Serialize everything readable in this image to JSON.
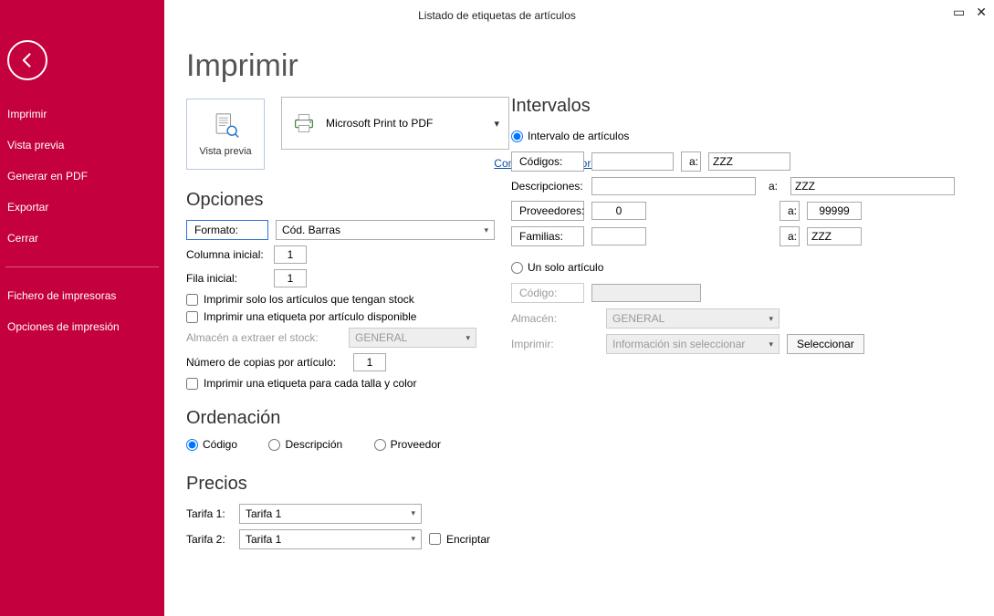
{
  "window": {
    "title": "Listado de etiquetas de artículos"
  },
  "sidebar": {
    "items": [
      "Imprimir",
      "Vista previa",
      "Generar en PDF",
      "Exportar",
      "Cerrar"
    ],
    "items2": [
      "Fichero de impresoras",
      "Opciones de impresión"
    ]
  },
  "main": {
    "title": "Imprimir",
    "preview_label": "Vista previa",
    "printer_name": "Microsoft Print to PDF",
    "configure_link": "Configurar impresora",
    "opciones": {
      "heading": "Opciones",
      "formato_label": "Formato:",
      "formato_value": "Cód. Barras",
      "col_label": "Columna inicial:",
      "col_value": "1",
      "fila_label": "Fila inicial:",
      "fila_value": "1",
      "chk_stock": "Imprimir solo los artículos que tengan stock",
      "chk_etiqueta_disp": "Imprimir una etiqueta por artículo disponible",
      "almacen_label": "Almacén a extraer el stock:",
      "almacen_value": "GENERAL",
      "copias_label": "Número de copias por artículo:",
      "copias_value": "1",
      "chk_talla": "Imprimir una etiqueta para cada talla y color"
    },
    "orden": {
      "heading": "Ordenación",
      "codigo": "Código",
      "desc": "Descripción",
      "prov": "Proveedor"
    },
    "precios": {
      "heading": "Precios",
      "t1_label": "Tarifa 1:",
      "t1_value": "Tarifa 1",
      "t2_label": "Tarifa 2:",
      "t2_value": "Tarifa 1",
      "encriptar": "Encriptar"
    }
  },
  "intervalos": {
    "heading": "Intervalos",
    "r1": "Intervalo de artículos",
    "codigos": "Códigos:",
    "codigos_to": "ZZZ",
    "desc": "Descripciones:",
    "desc_to": "ZZZ",
    "prov": "Proveedores:",
    "prov_from": "0",
    "prov_to": "99999",
    "fam": "Familias:",
    "fam_to": "ZZZ",
    "a": "a:",
    "r2": "Un solo artículo",
    "codigo": "Código:",
    "almacen_label": "Almacén:",
    "almacen_value": "GENERAL",
    "imprimir_label": "Imprimir:",
    "imprimir_value": "Información sin seleccionar",
    "seleccionar": "Seleccionar"
  }
}
